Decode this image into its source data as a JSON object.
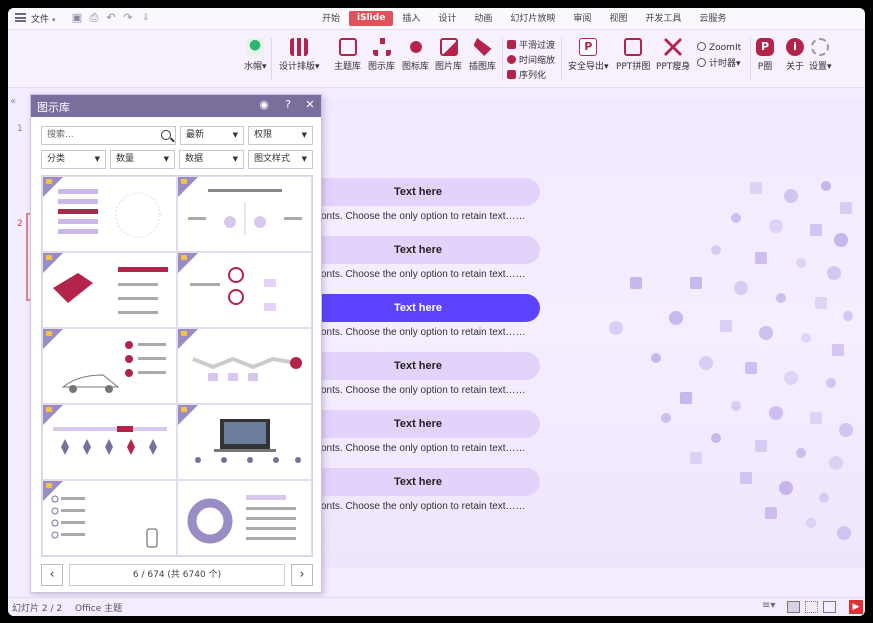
{
  "titlebar": {
    "file_label": "文件",
    "tabs": [
      {
        "label": "开始",
        "active": false
      },
      {
        "label": "iSlide",
        "active": true
      },
      {
        "label": "插入",
        "active": false
      },
      {
        "label": "设计",
        "active": false
      },
      {
        "label": "动画",
        "active": false
      },
      {
        "label": "幻灯片放映",
        "active": false
      },
      {
        "label": "审阅",
        "active": false
      },
      {
        "label": "视图",
        "active": false
      },
      {
        "label": "开发工具",
        "active": false
      },
      {
        "label": "云服务",
        "active": false
      }
    ]
  },
  "ribbon": {
    "watermark": "水帽",
    "layout": "设计排版",
    "theme_lib": "主题库",
    "diagram_lib": "图示库",
    "icon_lib": "图标库",
    "image_lib": "图片库",
    "illustration_lib": "插图库",
    "smooth": "平滑过渡",
    "time_zoom": "时间缩放",
    "sequence": "序列化",
    "safe_export": "安全导出",
    "ppt_merge": "PPT拼图",
    "ppt_slim": "PPT瘦身",
    "zoomit": "ZoomIt",
    "timer": "计时器",
    "p_chart": "P圈",
    "about": "关于",
    "settings": "设置"
  },
  "colors": {
    "accent": "#5b43ff",
    "tab_active": "#e0525a",
    "panel_header": "#7a6e9d"
  },
  "panel": {
    "title": "图示库",
    "search_placeholder": "搜索...",
    "filters": [
      "最新",
      "权限",
      "分类",
      "数量",
      "数据",
      "图文样式"
    ],
    "pager": {
      "info": "6 / 674 (共 6740 个)",
      "prev": "‹",
      "next": "›"
    }
  },
  "slide": {
    "items": [
      {
        "title": "Text here",
        "text": "onts. Choose the only option to retain text……",
        "highlighted": false
      },
      {
        "title": "Text here",
        "text": "onts. Choose the only option to retain text……",
        "highlighted": false
      },
      {
        "title": "Text here",
        "text": "onts. Choose the only option to retain text……",
        "highlighted": true
      },
      {
        "title": "Text here",
        "text": "onts. Choose the only option to retain text……",
        "highlighted": false
      },
      {
        "title": "Text here",
        "text": "onts. Choose the only option to retain text……",
        "highlighted": false
      },
      {
        "title": "Text here",
        "text": "onts. Choose the only option to retain text……",
        "highlighted": false
      }
    ]
  },
  "sidebar": {
    "slide_numbers": [
      "1",
      "2"
    ]
  },
  "status": {
    "slide": "幻灯片 2 / 2",
    "theme": "Office 主题"
  }
}
